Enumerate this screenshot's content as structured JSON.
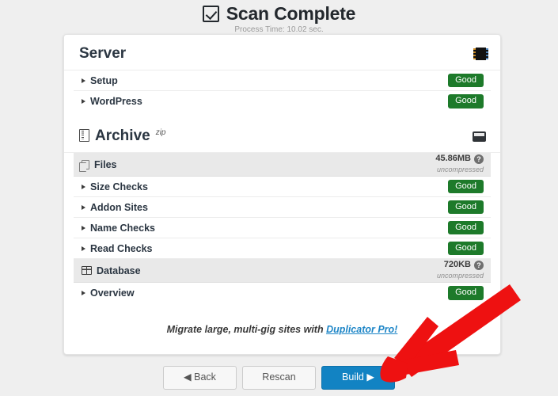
{
  "header": {
    "icon": "checkbox-checked-icon",
    "title": "Scan Complete",
    "subtitle": "Process Time: 10.02 sec."
  },
  "server_section": {
    "title": "Server",
    "icon": "server-rack-icon",
    "rows": [
      {
        "label": "Setup",
        "status": "Good"
      },
      {
        "label": "WordPress",
        "status": "Good"
      }
    ]
  },
  "archive_section": {
    "title": "Archive",
    "superscript": "zip",
    "title_icon": "archive-file-icon",
    "right_icon": "hard-drive-icon",
    "files": {
      "label": "Files",
      "icon": "files-copy-icon",
      "size": "45.86MB",
      "size_note": "uncompressed",
      "help_icon": "question-mark-icon"
    },
    "file_rows": [
      {
        "label": "Size Checks",
        "status": "Good"
      },
      {
        "label": "Addon Sites",
        "status": "Good"
      },
      {
        "label": "Name Checks",
        "status": "Good"
      },
      {
        "label": "Read Checks",
        "status": "Good"
      }
    ],
    "database": {
      "label": "Database",
      "icon": "table-grid-icon",
      "size": "720KB",
      "size_note": "uncompressed",
      "help_icon": "question-mark-icon"
    },
    "db_rows": [
      {
        "label": "Overview",
        "status": "Good"
      }
    ]
  },
  "promo": {
    "text_before": "Migrate large, multi-gig sites with ",
    "link_text": "Duplicator Pro!"
  },
  "buttons": {
    "back": "◀ Back",
    "rescan": "Rescan",
    "build": "Build ▶"
  },
  "annotation": {
    "type": "red-arrow",
    "color": "#EE1111",
    "points_to": "build-button"
  },
  "colors": {
    "page_background": "#EFEFEF",
    "panel_background": "#FFFFFF",
    "badge_good": "#1D7A2A",
    "primary_button": "#1283C3",
    "link": "#1E86C7",
    "annotation_red": "#EE1111"
  }
}
